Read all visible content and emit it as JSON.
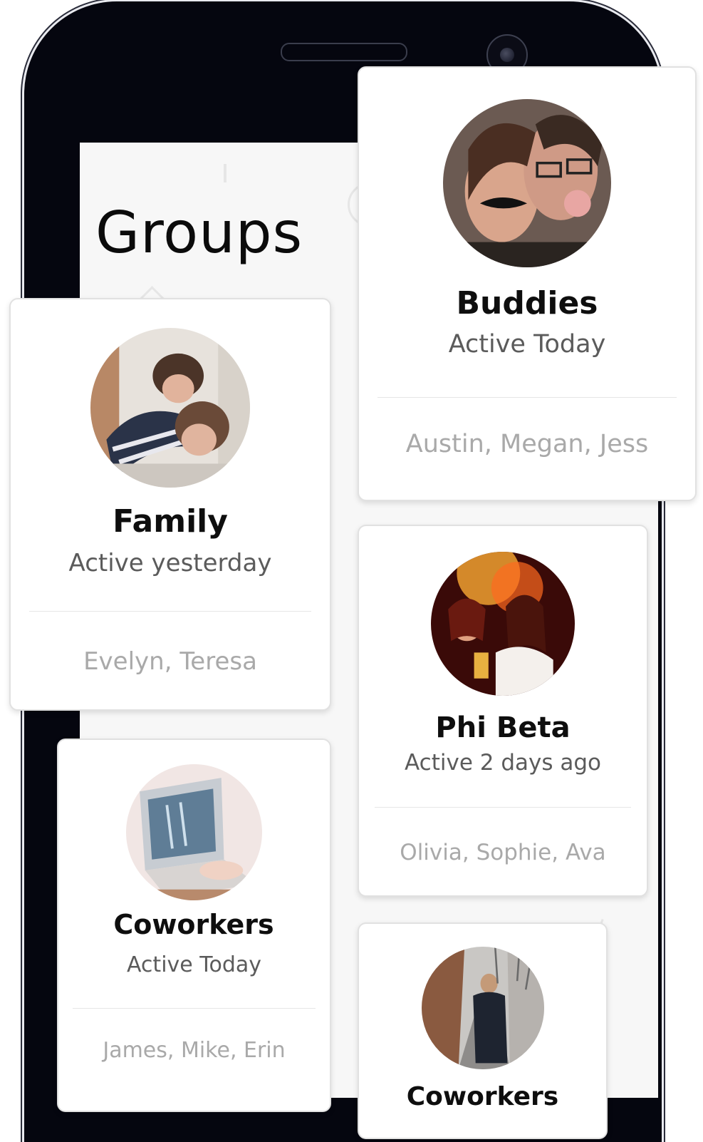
{
  "screen": {
    "title": "Groups"
  },
  "groups": [
    {
      "name": "Buddies",
      "status": "Active Today",
      "members": "Austin, Megan, Jess",
      "avatar": "couple-mustache-photo"
    },
    {
      "name": "Family",
      "status": "Active yesterday",
      "members": "Evelyn, Teresa",
      "avatar": "mother-child-photo"
    },
    {
      "name": "Phi Beta",
      "status": "Active 2 days ago",
      "members": "Olivia, Sophie, Ava",
      "avatar": "party-photo"
    },
    {
      "name": "Coworkers",
      "status": "Active Today",
      "members": "James, Mike, Erin",
      "avatar": "laptop-typing-photo"
    },
    {
      "name": "Coworkers",
      "avatar": "street-walker-photo"
    }
  ],
  "colors": {
    "phone_body": "#05060f",
    "screen_bg": "#f7f7f7",
    "card_bg": "#ffffff",
    "name_text": "#0e0e0e",
    "status_text": "#5b5b5b",
    "members_text": "#a9a9a9"
  }
}
